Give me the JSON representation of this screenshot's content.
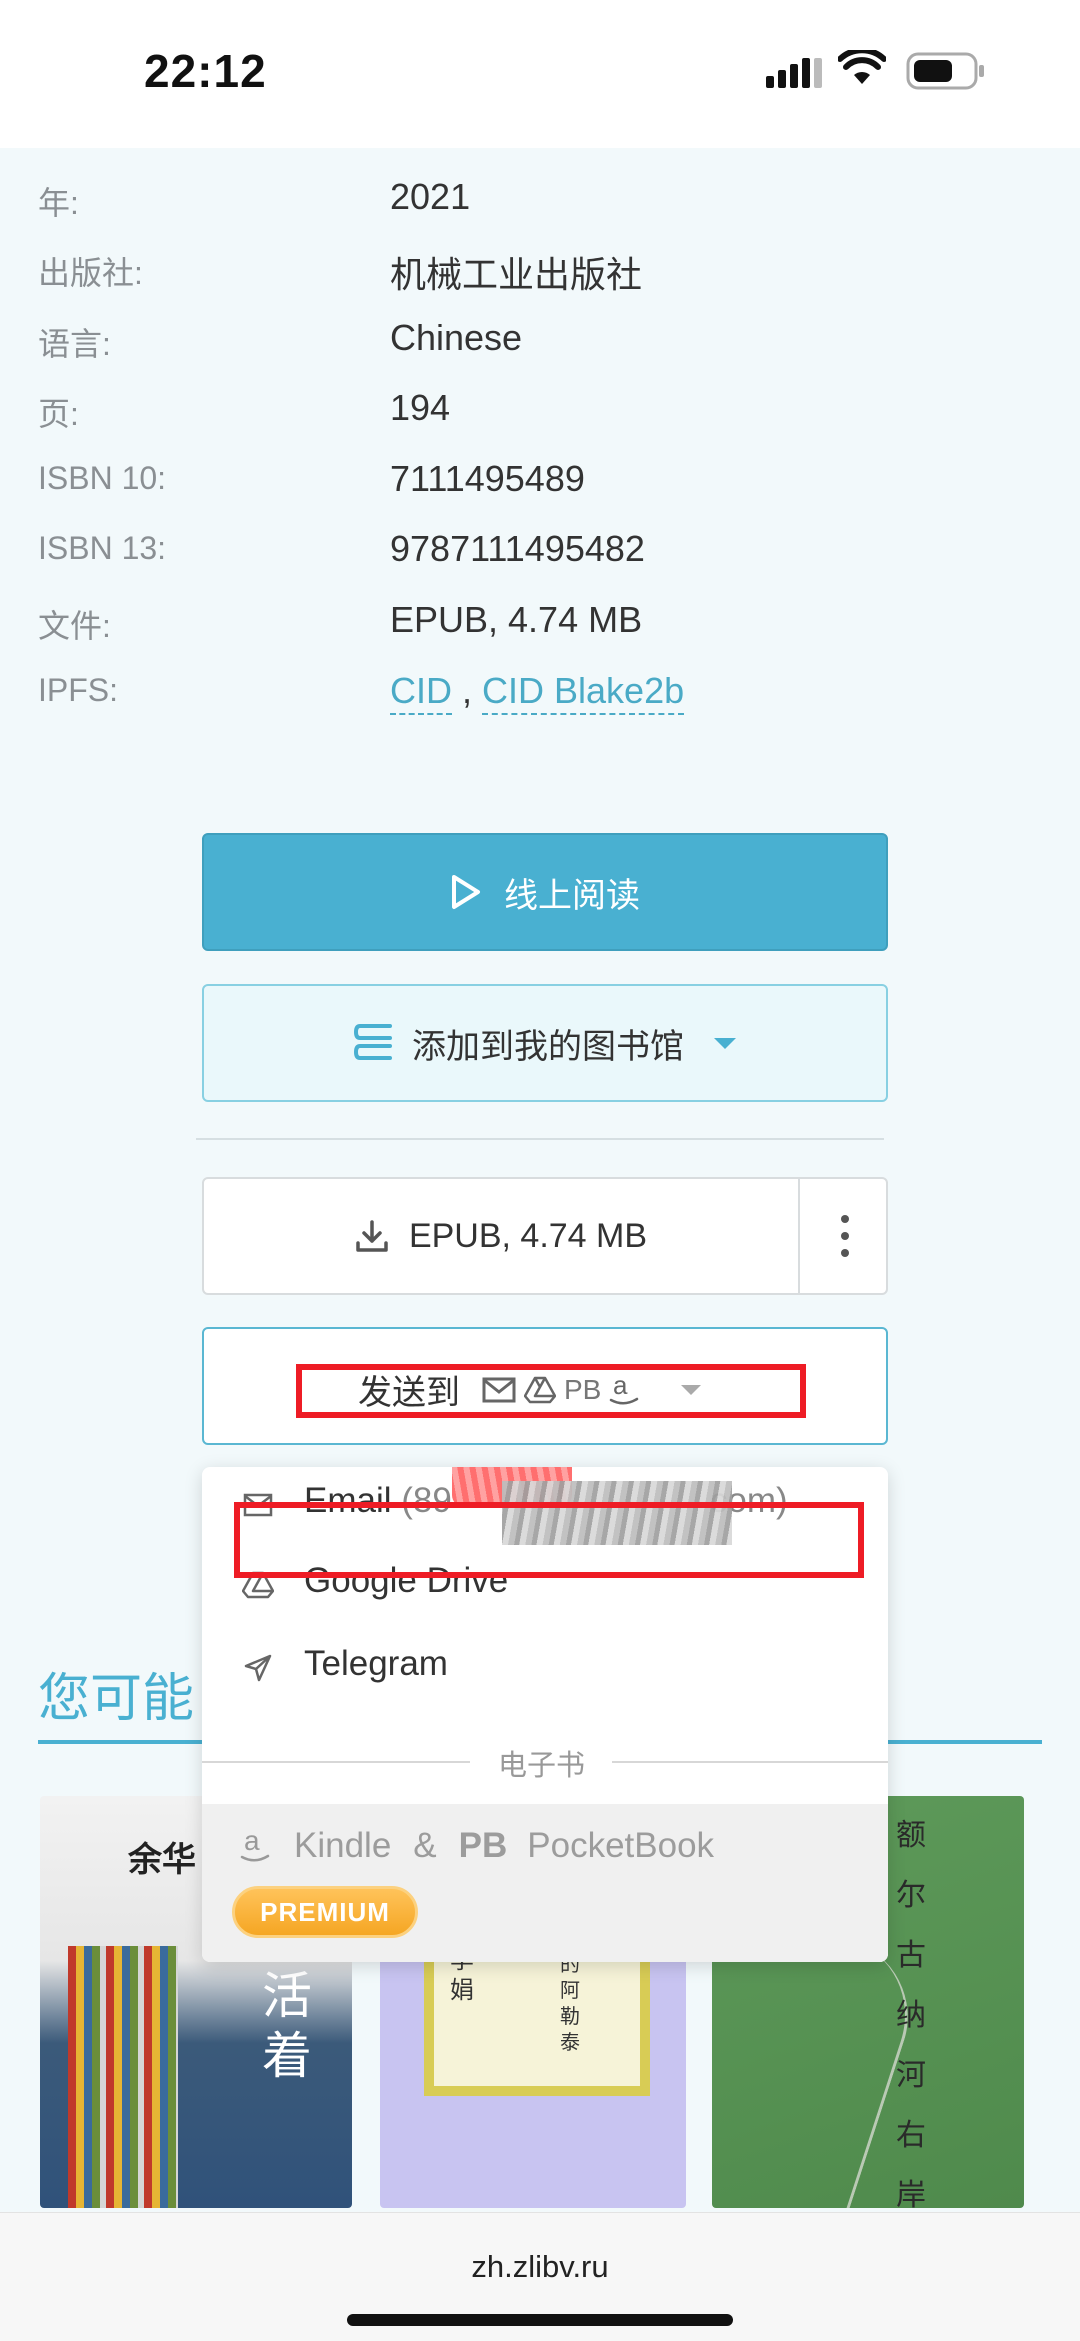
{
  "status_bar": {
    "time": "22:12"
  },
  "details": [
    {
      "label": "年:",
      "value": "2021"
    },
    {
      "label": "出版社:",
      "value": "机械工业出版社"
    },
    {
      "label": "语言:",
      "value": "Chinese"
    },
    {
      "label": "页:",
      "value": "194"
    },
    {
      "label": "ISBN 10:",
      "value": "7111495489"
    },
    {
      "label": "ISBN 13:",
      "value": "9787111495482"
    },
    {
      "label": "文件:",
      "value": "EPUB, 4.74 MB"
    }
  ],
  "ipfs": {
    "label": "IPFS:",
    "link1": "CID",
    "separator": ",",
    "link2": "CID Blake2b"
  },
  "buttons": {
    "read_online": "线上阅读",
    "add_to_library": "添加到我的图书馆",
    "download": "EPUB, 4.74 MB",
    "send_to": "发送到",
    "send_pb": "PB"
  },
  "dropdown": {
    "email_label": "Email",
    "email_prefix": "(89",
    "email_suffix": "com)",
    "gdrive_label": "Google Drive",
    "telegram_label": "Telegram",
    "ebook_separator": "电子书",
    "kindle_label": "Kindle",
    "amp": "&",
    "pb_mark": "PB",
    "pocketbook_label": "PocketBook",
    "premium_badge": "PREMIUM"
  },
  "section": {
    "title": "您可能"
  },
  "covers": [
    {
      "title_top": "余华",
      "title_vertical": "活着"
    },
    {
      "author": "李娟",
      "book": "我的阿勒泰"
    },
    {
      "vertical": "额尔古纳河右岸"
    }
  ],
  "browser": {
    "url": "zh.zlibv.ru"
  },
  "colors": {
    "accent": "#49b0d1",
    "annotation": "#ee1c25",
    "premium": "#f5a623"
  }
}
